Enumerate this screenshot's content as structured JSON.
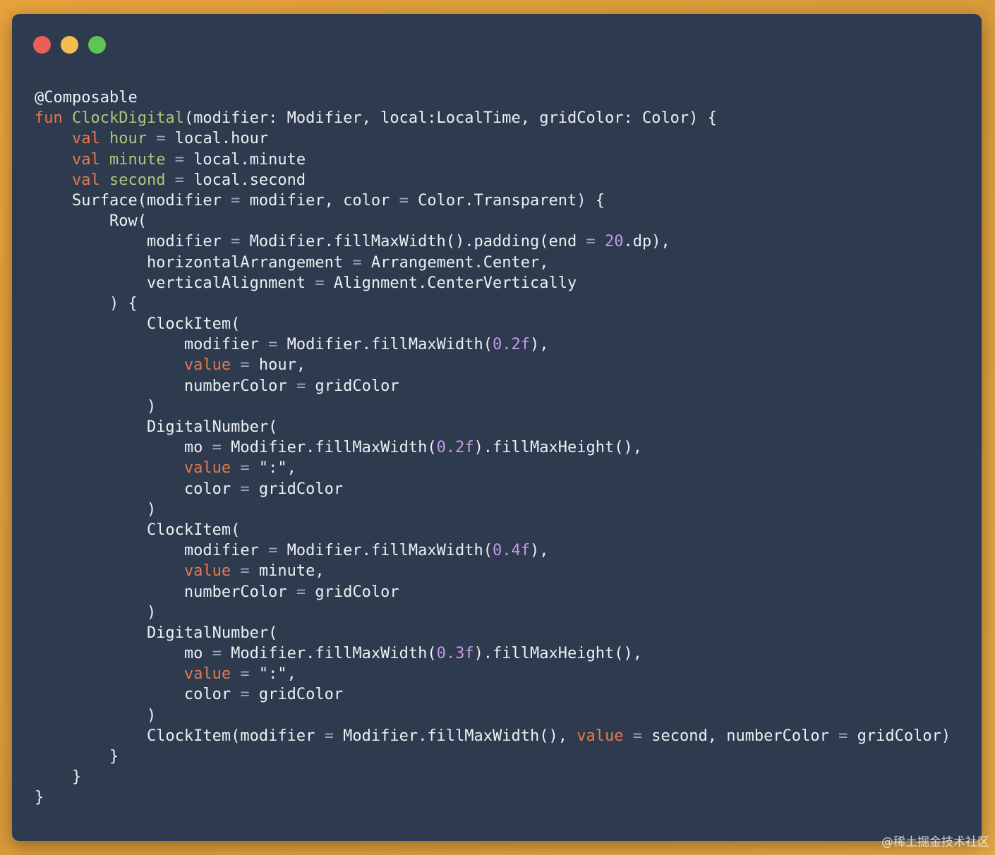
{
  "window": {
    "controls": [
      {
        "name": "close",
        "color": "#ec5f57"
      },
      {
        "name": "minimize",
        "color": "#f5bd4f"
      },
      {
        "name": "zoom",
        "color": "#5fc453"
      }
    ]
  },
  "colors": {
    "plain": "#eceff4",
    "keyword": "#e8784f",
    "identifier": "#a8c97c",
    "number": "#c49ae8",
    "operator": "#8fa9c9"
  },
  "code": {
    "lines": [
      [
        [
          "plain",
          "@Composable"
        ]
      ],
      [
        [
          "keyword",
          "fun "
        ],
        [
          "identifier",
          "ClockDigital"
        ],
        [
          "plain",
          "(modifier: Modifier, local:LocalTime, gridColor: Color) {"
        ]
      ],
      [
        [
          "plain",
          "    "
        ],
        [
          "keyword",
          "val "
        ],
        [
          "identifier",
          "hour "
        ],
        [
          "operator",
          "= "
        ],
        [
          "plain",
          "local.hour"
        ]
      ],
      [
        [
          "plain",
          "    "
        ],
        [
          "keyword",
          "val "
        ],
        [
          "identifier",
          "minute "
        ],
        [
          "operator",
          "= "
        ],
        [
          "plain",
          "local.minute"
        ]
      ],
      [
        [
          "plain",
          "    "
        ],
        [
          "keyword",
          "val "
        ],
        [
          "identifier",
          "second "
        ],
        [
          "operator",
          "= "
        ],
        [
          "plain",
          "local.second"
        ]
      ],
      [
        [
          "plain",
          "    Surface(modifier "
        ],
        [
          "operator",
          "= "
        ],
        [
          "plain",
          "modifier, color "
        ],
        [
          "operator",
          "= "
        ],
        [
          "plain",
          "Color.Transparent) {"
        ]
      ],
      [
        [
          "plain",
          "        Row("
        ]
      ],
      [
        [
          "plain",
          "            modifier "
        ],
        [
          "operator",
          "= "
        ],
        [
          "plain",
          "Modifier.fillMaxWidth().padding(end "
        ],
        [
          "operator",
          "= "
        ],
        [
          "number",
          "20"
        ],
        [
          "plain",
          ".dp),"
        ]
      ],
      [
        [
          "plain",
          "            horizontalArrangement "
        ],
        [
          "operator",
          "= "
        ],
        [
          "plain",
          "Arrangement.Center,"
        ]
      ],
      [
        [
          "plain",
          "            verticalAlignment "
        ],
        [
          "operator",
          "= "
        ],
        [
          "plain",
          "Alignment.CenterVertically"
        ]
      ],
      [
        [
          "plain",
          "        ) {"
        ]
      ],
      [
        [
          "plain",
          "            ClockItem("
        ]
      ],
      [
        [
          "plain",
          "                modifier "
        ],
        [
          "operator",
          "= "
        ],
        [
          "plain",
          "Modifier.fillMaxWidth("
        ],
        [
          "number",
          "0.2f"
        ],
        [
          "plain",
          "),"
        ]
      ],
      [
        [
          "plain",
          "                "
        ],
        [
          "keyword",
          "value "
        ],
        [
          "operator",
          "= "
        ],
        [
          "plain",
          "hour,"
        ]
      ],
      [
        [
          "plain",
          "                numberColor "
        ],
        [
          "operator",
          "= "
        ],
        [
          "plain",
          "gridColor"
        ]
      ],
      [
        [
          "plain",
          "            )"
        ]
      ],
      [
        [
          "plain",
          "            DigitalNumber("
        ]
      ],
      [
        [
          "plain",
          "                mo "
        ],
        [
          "operator",
          "= "
        ],
        [
          "plain",
          "Modifier.fillMaxWidth("
        ],
        [
          "number",
          "0.2f"
        ],
        [
          "plain",
          ").fillMaxHeight(),"
        ]
      ],
      [
        [
          "plain",
          "                "
        ],
        [
          "keyword",
          "value "
        ],
        [
          "operator",
          "= "
        ],
        [
          "plain",
          "\":\","
        ]
      ],
      [
        [
          "plain",
          "                color "
        ],
        [
          "operator",
          "= "
        ],
        [
          "plain",
          "gridColor"
        ]
      ],
      [
        [
          "plain",
          "            )"
        ]
      ],
      [
        [
          "plain",
          "            ClockItem("
        ]
      ],
      [
        [
          "plain",
          "                modifier "
        ],
        [
          "operator",
          "= "
        ],
        [
          "plain",
          "Modifier.fillMaxWidth("
        ],
        [
          "number",
          "0.4f"
        ],
        [
          "plain",
          "),"
        ]
      ],
      [
        [
          "plain",
          "                "
        ],
        [
          "keyword",
          "value "
        ],
        [
          "operator",
          "= "
        ],
        [
          "plain",
          "minute,"
        ]
      ],
      [
        [
          "plain",
          "                numberColor "
        ],
        [
          "operator",
          "= "
        ],
        [
          "plain",
          "gridColor"
        ]
      ],
      [
        [
          "plain",
          "            )"
        ]
      ],
      [
        [
          "plain",
          "            DigitalNumber("
        ]
      ],
      [
        [
          "plain",
          "                mo "
        ],
        [
          "operator",
          "= "
        ],
        [
          "plain",
          "Modifier.fillMaxWidth("
        ],
        [
          "number",
          "0.3f"
        ],
        [
          "plain",
          ").fillMaxHeight(),"
        ]
      ],
      [
        [
          "plain",
          "                "
        ],
        [
          "keyword",
          "value "
        ],
        [
          "operator",
          "= "
        ],
        [
          "plain",
          "\":\","
        ]
      ],
      [
        [
          "plain",
          "                color "
        ],
        [
          "operator",
          "= "
        ],
        [
          "plain",
          "gridColor"
        ]
      ],
      [
        [
          "plain",
          "            )"
        ]
      ],
      [
        [
          "plain",
          "            ClockItem(modifier "
        ],
        [
          "operator",
          "= "
        ],
        [
          "plain",
          "Modifier.fillMaxWidth(), "
        ],
        [
          "keyword",
          "value "
        ],
        [
          "operator",
          "= "
        ],
        [
          "plain",
          "second, numberColor "
        ],
        [
          "operator",
          "= "
        ],
        [
          "plain",
          "gridColor)"
        ]
      ],
      [
        [
          "plain",
          "        }"
        ]
      ],
      [
        [
          "plain",
          "    }"
        ]
      ],
      [
        [
          "plain",
          "}"
        ]
      ]
    ]
  },
  "watermark": "@稀土掘金技术社区"
}
